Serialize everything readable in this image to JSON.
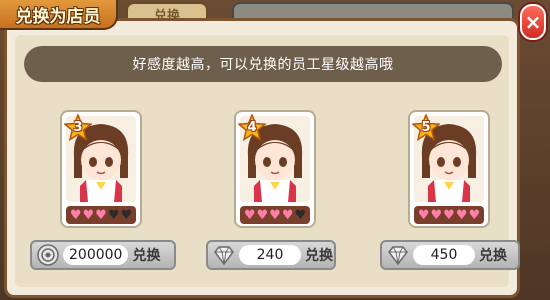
{
  "header": {
    "title": "兑换为店员",
    "tab_b": "兑换",
    "close_symbol": "×"
  },
  "hint": "好感度越高，可以兑换的员工星级越高哦",
  "cards": [
    {
      "stars": "3",
      "hearts_filled": 3,
      "hearts_total": 5,
      "price": "200000",
      "currency_icon": "coin-icon",
      "action": "兑换"
    },
    {
      "stars": "4",
      "hearts_filled": 4,
      "hearts_total": 5,
      "price": "240",
      "currency_icon": "diamond-icon",
      "action": "兑换"
    },
    {
      "stars": "5",
      "hearts_filled": 5,
      "hearts_total": 5,
      "price": "450",
      "currency_icon": "diamond-icon",
      "action": "兑换"
    }
  ],
  "colors": {
    "accent": "#e39a3d",
    "heart_on": "#ff7fa8",
    "heart_off": "#2b2b2b",
    "close": "#d32c22"
  }
}
